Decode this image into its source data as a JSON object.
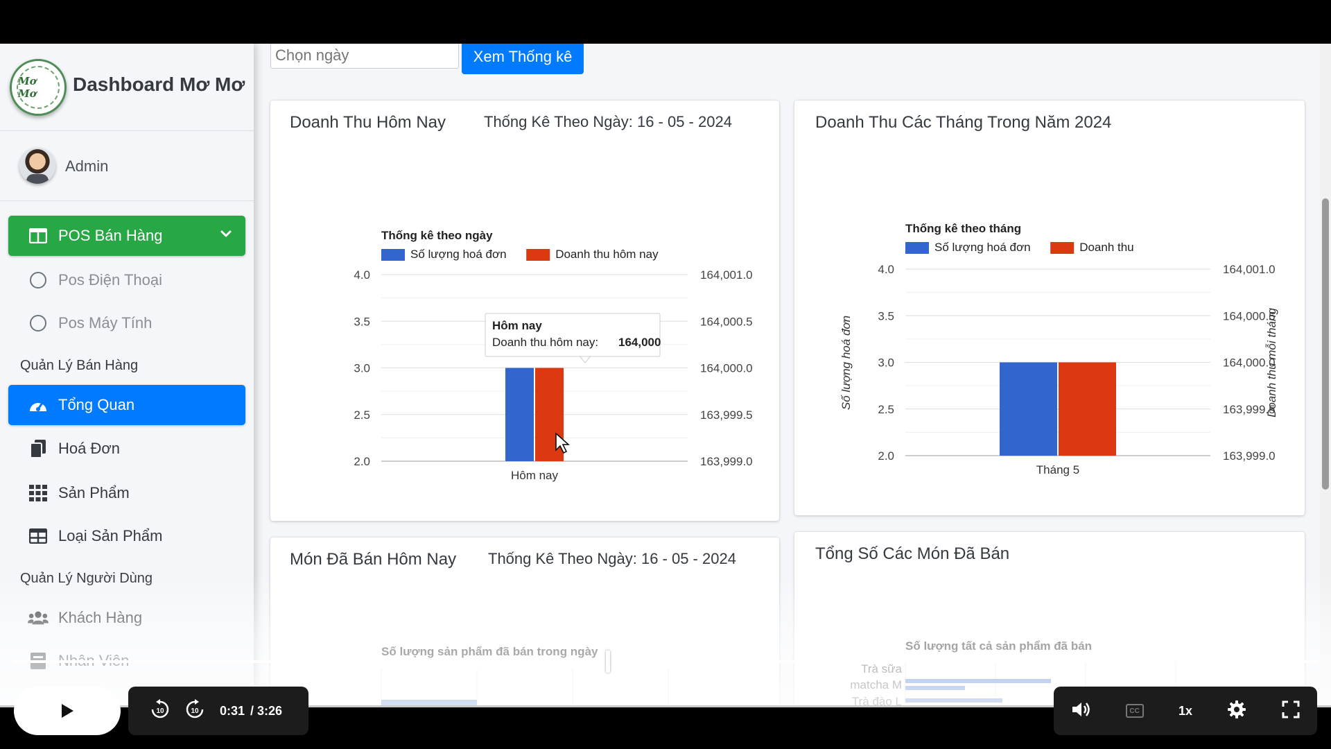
{
  "brand": {
    "title": "Dashboard Mơ Mơ",
    "logo_text": "Mơ Mơ"
  },
  "user": {
    "name": "Admin"
  },
  "sidebar": {
    "pos": "POS Bán Hàng",
    "pos_phone": "Pos Điện Thoại",
    "pos_pc": "Pos Máy Tính",
    "section_sales": "Quản Lý Bán Hàng",
    "overview": "Tổng Quan",
    "invoices": "Hoá Đơn",
    "products": "Sản Phẩm",
    "categories": "Loại Sản Phẩm",
    "section_users": "Quản Lý Người Dùng",
    "customers": "Khách Hàng",
    "staff": "Nhân Viên"
  },
  "toolbar": {
    "date_placeholder": "Chọn ngày",
    "stats_button": "Xem Thống kê"
  },
  "cards": {
    "today": {
      "title": "Doanh Thu Hôm Nay",
      "subtitle": "Thống Kê Theo Ngày: 16 - 05 - 2024"
    },
    "months": {
      "title": "Doanh Thu Các Tháng Trong Năm 2024"
    },
    "sold_today": {
      "title": "Món Đã Bán Hôm Nay",
      "subtitle": "Thống Kê Theo Ngày: 16 - 05 - 2024"
    },
    "sold_total": {
      "title": "Tổng Số Các Món Đã Bán"
    }
  },
  "chart_data": [
    {
      "type": "bar",
      "title": "Thống kê theo ngày",
      "categories": [
        "Hôm nay"
      ],
      "series": [
        {
          "name": "Số lượng hoá đơn",
          "values": [
            3
          ],
          "axis": "left",
          "color": "#3366cc"
        },
        {
          "name": "Doanh thu hôm nay",
          "values": [
            164000
          ],
          "axis": "right",
          "color": "#dc3912"
        }
      ],
      "ylim_left": [
        2.0,
        4.0
      ],
      "ylim_right": [
        163999.0,
        164001.0
      ],
      "left_ticks": [
        "4.0",
        "3.5",
        "3.0",
        "2.5",
        "2.0"
      ],
      "right_ticks": [
        "164,001.0",
        "164,000.5",
        "164,000.0",
        "163,999.5",
        "163,999.0"
      ],
      "legend": "top",
      "tooltip": {
        "title": "Hôm nay",
        "label": "Doanh thu hôm nay:",
        "value": "164,000"
      }
    },
    {
      "type": "bar",
      "title": "Thống kê theo tháng",
      "categories": [
        "Tháng 5"
      ],
      "series": [
        {
          "name": "Số lượng hoá đơn",
          "values": [
            3
          ],
          "axis": "left",
          "color": "#3366cc"
        },
        {
          "name": "Doanh thu",
          "values": [
            164000
          ],
          "axis": "right",
          "color": "#dc3912"
        }
      ],
      "ylabel_left": "Số lượng hoá đơn",
      "ylabel_right": "Doanh thu mỗi tháng",
      "ylim_left": [
        2.0,
        4.0
      ],
      "ylim_right": [
        163999.0,
        164001.0
      ],
      "left_ticks": [
        "4.0",
        "3.5",
        "3.0",
        "2.5",
        "2.0"
      ],
      "right_ticks": [
        "164,001.0",
        "164,000.5",
        "164,000.0",
        "163,999.5",
        "163,999.0"
      ],
      "legend": "top"
    },
    {
      "type": "bar",
      "title": "Số lượng sản phẩm đã bán trong ngày"
    },
    {
      "type": "bar",
      "title": "Số lượng tất cả sản phẩm đã bán",
      "categories": [
        "Trà sữa matcha M",
        "Trà đào L"
      ]
    }
  ],
  "player": {
    "current_time": "0:31",
    "duration": "/ 3:26",
    "progress": 0.456,
    "speed": "1x",
    "cc": "CC",
    "icons": [
      "play-icon",
      "rewind-10-icon",
      "forward-10-icon",
      "volume-icon",
      "captions-icon",
      "settings-icon",
      "fullscreen-icon"
    ]
  }
}
